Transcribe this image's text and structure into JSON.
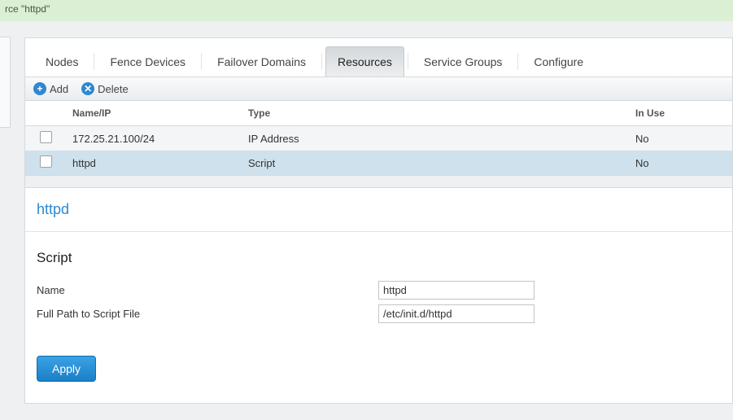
{
  "banner": {
    "text": "rce \"httpd\""
  },
  "tabs": {
    "items": [
      {
        "label": "Nodes"
      },
      {
        "label": "Fence Devices"
      },
      {
        "label": "Failover Domains"
      },
      {
        "label": "Resources"
      },
      {
        "label": "Service Groups"
      },
      {
        "label": "Configure"
      }
    ],
    "active_index": 3
  },
  "toolbar": {
    "add_label": "Add",
    "delete_label": "Delete"
  },
  "table": {
    "headers": {
      "name": "Name/IP",
      "type": "Type",
      "inuse": "In Use"
    },
    "rows": [
      {
        "name": "172.25.21.100/24",
        "type": "IP Address",
        "inuse": "No"
      },
      {
        "name": "httpd",
        "type": "Script",
        "inuse": "No"
      }
    ]
  },
  "detail": {
    "title": "httpd",
    "section": "Script",
    "fields": {
      "name": {
        "label": "Name",
        "value": "httpd"
      },
      "script": {
        "label": "Full Path to Script File",
        "value": "/etc/init.d/httpd"
      }
    },
    "apply_label": "Apply"
  }
}
